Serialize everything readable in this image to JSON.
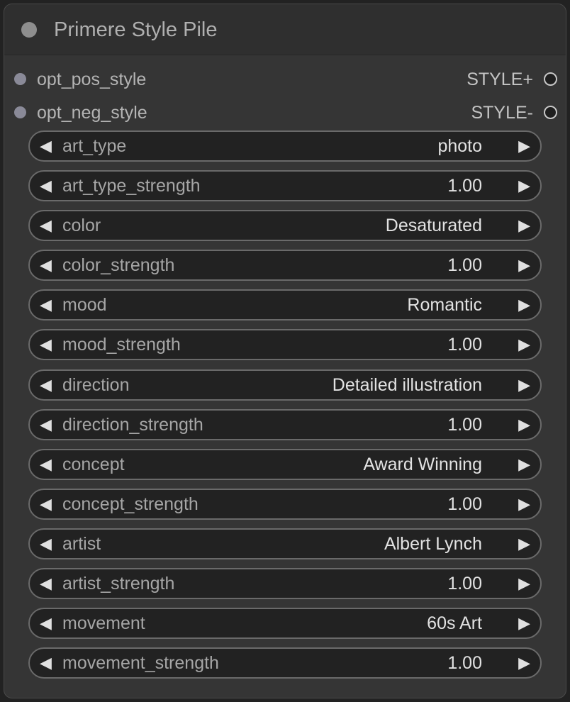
{
  "node": {
    "title": "Primere Style Pile"
  },
  "inputs": [
    {
      "label": "opt_pos_style"
    },
    {
      "label": "opt_neg_style"
    }
  ],
  "outputs": [
    {
      "label": "STYLE+"
    },
    {
      "label": "STYLE-"
    }
  ],
  "icons": {
    "decrement": "◀",
    "increment": "▶"
  },
  "widgets": [
    {
      "label": "art_type",
      "value": "photo"
    },
    {
      "label": "art_type_strength",
      "value": "1.00"
    },
    {
      "label": "color",
      "value": "Desaturated"
    },
    {
      "label": "color_strength",
      "value": "1.00"
    },
    {
      "label": "mood",
      "value": "Romantic"
    },
    {
      "label": "mood_strength",
      "value": "1.00"
    },
    {
      "label": "direction",
      "value": "Detailed illustration"
    },
    {
      "label": "direction_strength",
      "value": "1.00"
    },
    {
      "label": "concept",
      "value": "Award Winning"
    },
    {
      "label": "concept_strength",
      "value": "1.00"
    },
    {
      "label": "artist",
      "value": "Albert Lynch"
    },
    {
      "label": "artist_strength",
      "value": "1.00"
    },
    {
      "label": "movement",
      "value": "60s Art"
    },
    {
      "label": "movement_strength",
      "value": "1.00"
    }
  ]
}
